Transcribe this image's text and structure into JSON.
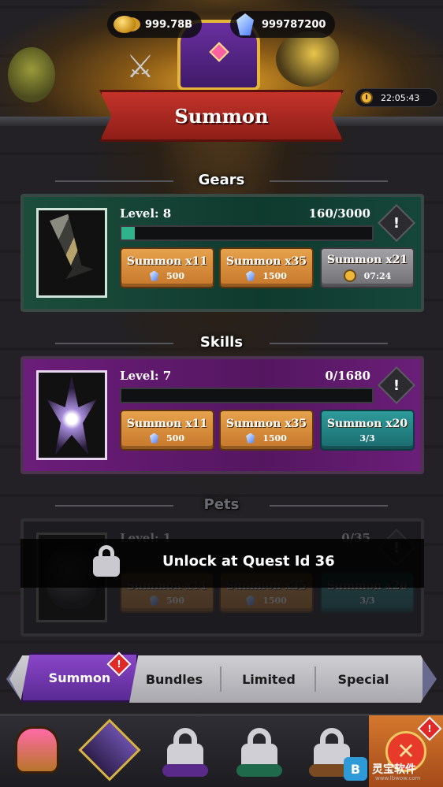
{
  "header": {
    "gold": "999.78B",
    "crystals": "999787200",
    "timer": "22:05:43",
    "title": "Summon"
  },
  "sections": {
    "gears": {
      "title": "Gears",
      "level": "Level: 8",
      "progress": "160/3000",
      "progress_fraction": 0.053,
      "info": "!",
      "buttons": [
        {
          "label": "Summon x11",
          "cost": "500",
          "style": "orange",
          "icon": "crystal-icon"
        },
        {
          "label": "Summon x35",
          "cost": "1500",
          "style": "orange",
          "icon": "crystal-icon"
        },
        {
          "label": "Summon x21",
          "cost": "07:24",
          "style": "gray",
          "icon": "clock-icon"
        }
      ]
    },
    "skills": {
      "title": "Skills",
      "level": "Level: 7",
      "progress": "0/1680",
      "progress_fraction": 0,
      "info": "!",
      "buttons": [
        {
          "label": "Summon x11",
          "cost": "500",
          "style": "orange",
          "icon": "crystal-icon"
        },
        {
          "label": "Summon x35",
          "cost": "1500",
          "style": "orange",
          "icon": "crystal-icon"
        },
        {
          "label": "Summon x20",
          "cost": "3/3",
          "style": "teal",
          "icon": ""
        }
      ]
    },
    "pets": {
      "title": "Pets",
      "level": "Level: 1",
      "progress": "0/35",
      "info": "!",
      "lock_text": "Unlock at Quest Id 36",
      "buttons": [
        {
          "label": "Summon x11",
          "cost": "500"
        },
        {
          "label": "Summon x35",
          "cost": "1500"
        },
        {
          "label": "Summon x20",
          "cost": "3/3"
        }
      ]
    }
  },
  "tabs": {
    "items": [
      "Summon",
      "Bundles",
      "Limited",
      "Special"
    ],
    "active": "Summon",
    "alert": "!"
  },
  "bottom_nav": {
    "items": [
      "helmet-icon",
      "emblem-icon",
      "lock-icon",
      "lock-icon",
      "lock-icon",
      "close-icon"
    ],
    "alert": "!"
  },
  "watermark": {
    "logo": "B",
    "text": "灵宝软件",
    "sub": "www.lbwow.com"
  }
}
